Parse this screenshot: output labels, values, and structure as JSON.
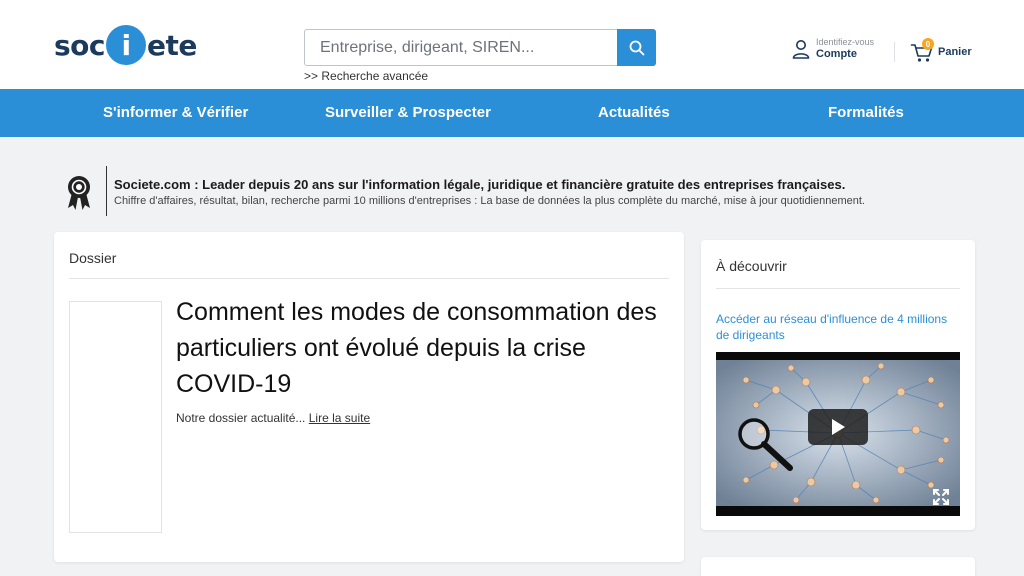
{
  "header": {
    "logo": {
      "text_before": "soc",
      "text_i": "i",
      "text_after": "ete"
    },
    "search": {
      "placeholder": "Entreprise, dirigeant, SIREN...",
      "value": ""
    },
    "advanced_search": ">> Recherche avancée",
    "account": {
      "small": "Identifiez-vous",
      "label": "Compte"
    },
    "cart": {
      "count": "0",
      "label": "Panier"
    }
  },
  "nav": {
    "items": [
      {
        "label": "S'informer & Vérifier"
      },
      {
        "label": "Surveiller & Prospecter"
      },
      {
        "label": "Actualités"
      },
      {
        "label": "Formalités"
      }
    ]
  },
  "banner": {
    "title": "Societe.com : Leader depuis 20 ans sur l'information légale, juridique et financière gratuite des entreprises françaises.",
    "subtitle": "Chiffre d'affaires, résultat, bilan, recherche parmi 10 millions d'entreprises : La base de données la plus complète du marché, mise à jour quotidiennement."
  },
  "dossier": {
    "heading": "Dossier",
    "article_title": "Comment les modes de consommation des particuliers ont évolué depuis la crise COVID-19",
    "excerpt": "Notre dossier actualité...",
    "read_more": "Lire la suite"
  },
  "discover": {
    "heading": "À découvrir",
    "link": "Accéder au réseau d'influence de 4 millions de dirigeants"
  },
  "icons": {
    "search": "search-icon",
    "account": "user-icon",
    "cart": "cart-icon",
    "award": "award-icon",
    "play": "play-icon",
    "expand": "expand-icon"
  },
  "colors": {
    "brand_blue": "#2b8fd8",
    "brand_navy": "#1b3a5c",
    "badge_orange": "#f5a623",
    "page_bg": "#f1f2f4"
  }
}
